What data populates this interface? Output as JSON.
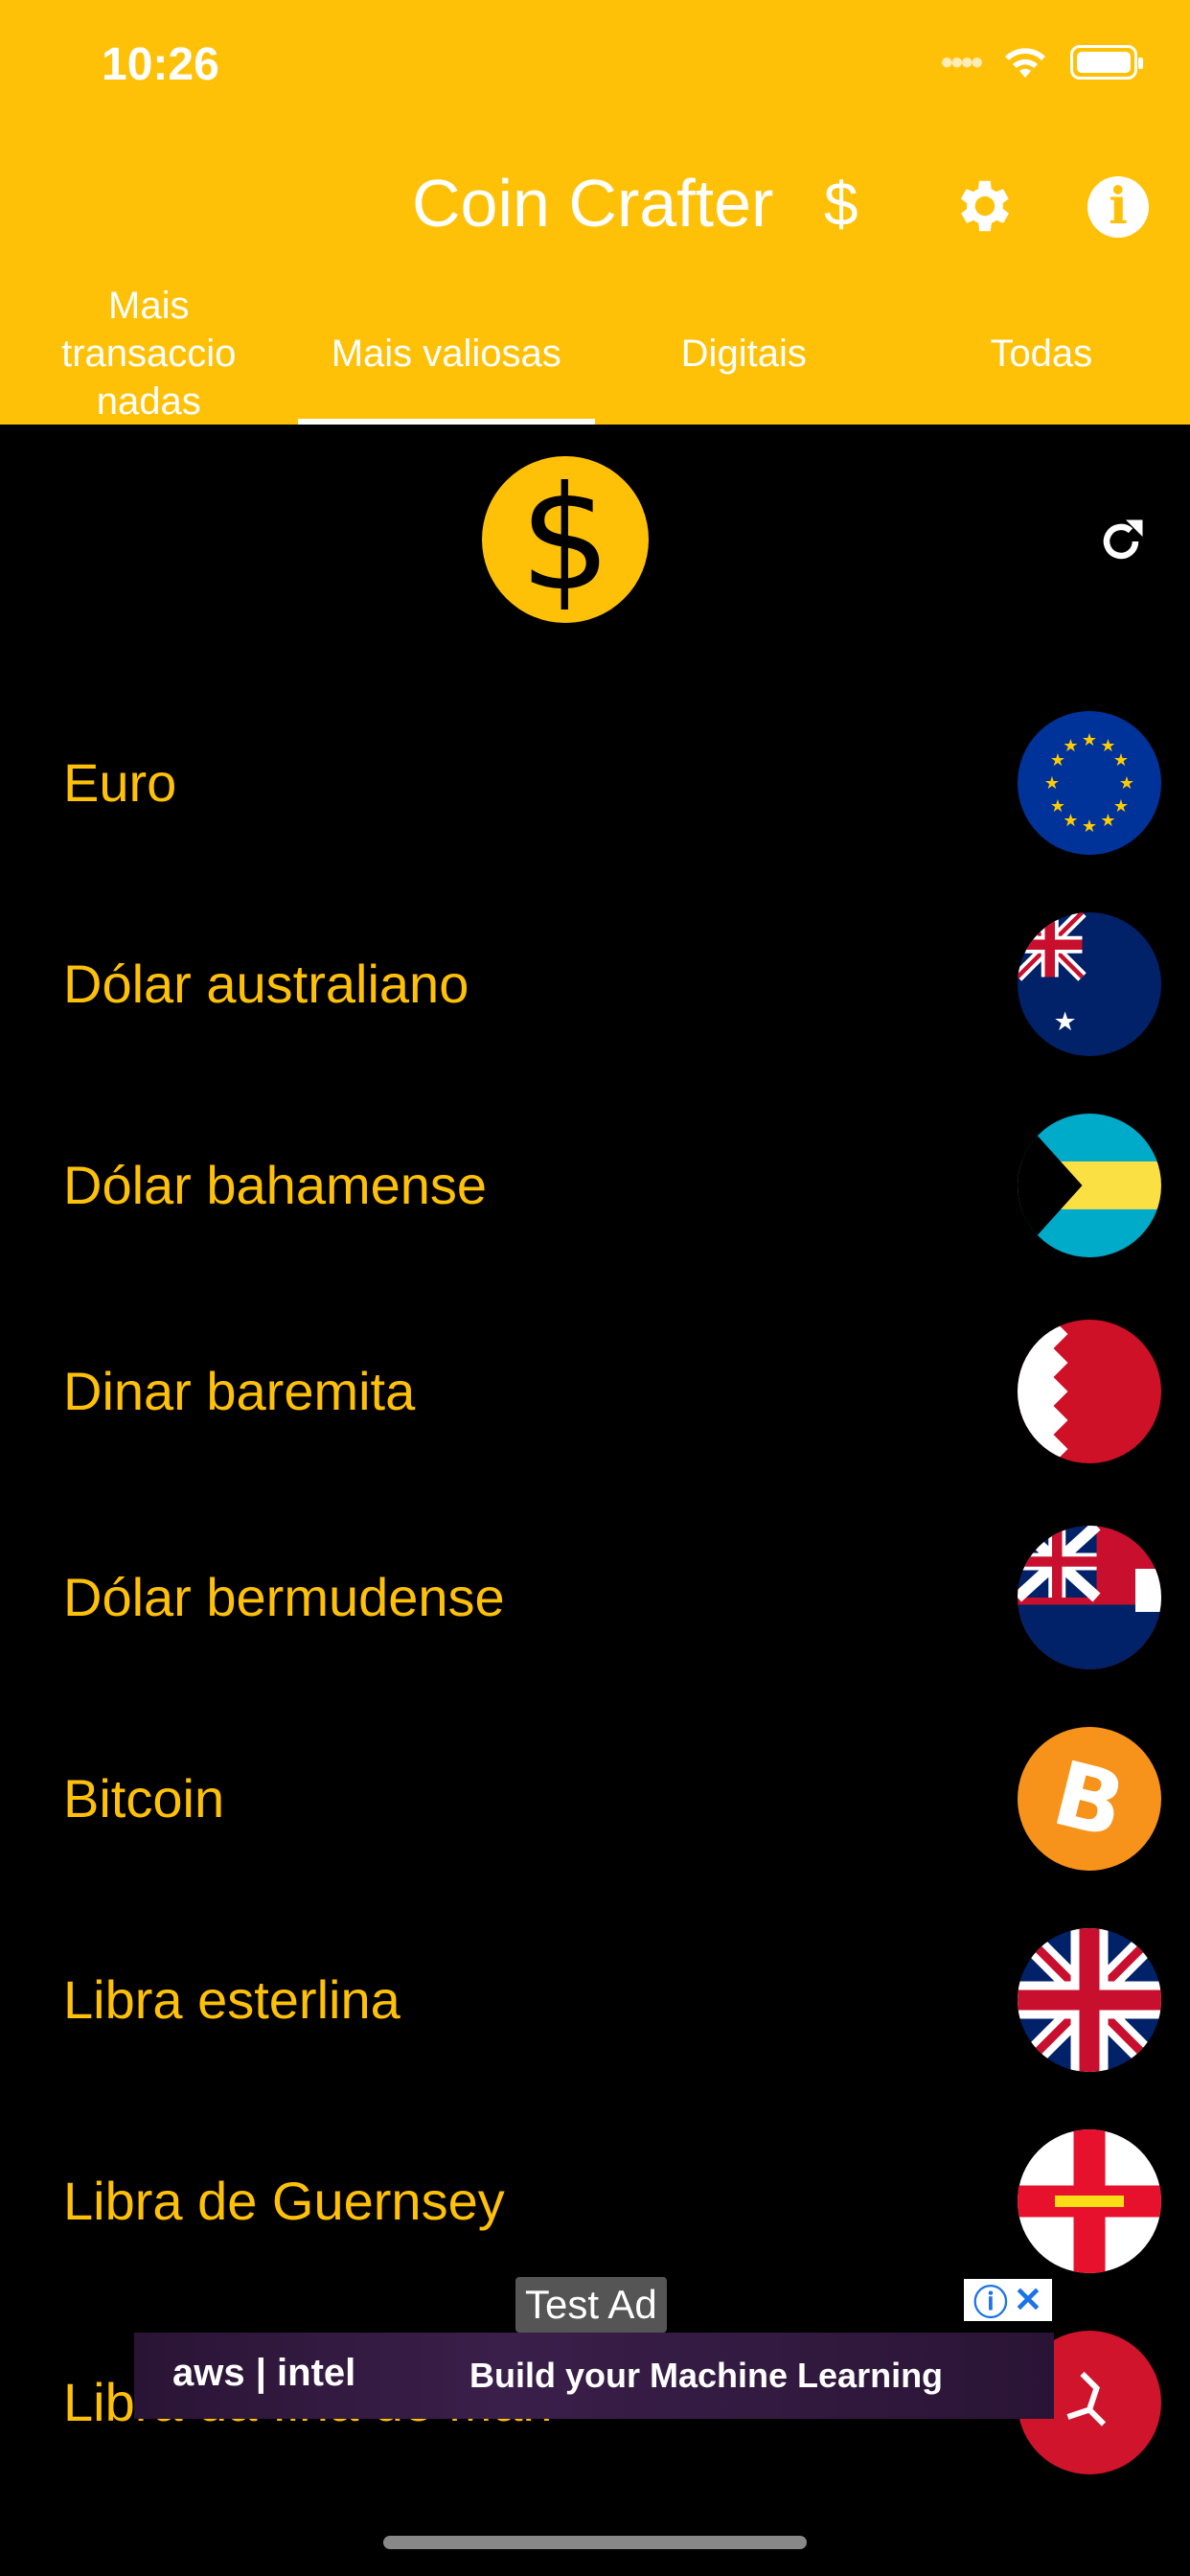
{
  "status_bar": {
    "time": "10:26"
  },
  "header": {
    "title": "Coin Crafter",
    "dollar_label": "$",
    "settings_icon": "gear-icon",
    "info_icon": "info-icon"
  },
  "tabs": [
    {
      "label": "Mais transaccio nadas",
      "active": false
    },
    {
      "label": "Mais valiosas",
      "active": true
    },
    {
      "label": "Digitais",
      "active": false
    },
    {
      "label": "Todas",
      "active": false
    }
  ],
  "logo": {
    "symbol": "$"
  },
  "currencies": [
    {
      "name": "Euro",
      "flag": "eu-flag"
    },
    {
      "name": "Dólar australiano",
      "flag": "australia-flag"
    },
    {
      "name": "Dólar bahamense",
      "flag": "bahamas-flag"
    },
    {
      "name": "Dinar baremita",
      "flag": "bahrain-flag"
    },
    {
      "name": "Dólar bermudense",
      "flag": "bermuda-flag"
    },
    {
      "name": "Bitcoin",
      "flag": "bitcoin-icon"
    },
    {
      "name": "Libra esterlina",
      "flag": "uk-flag"
    },
    {
      "name": "Libra de Guernsey",
      "flag": "guernsey-flag"
    },
    {
      "name": "Libra da Ilha de Man",
      "flag": "isle-of-man-flag"
    }
  ],
  "ad": {
    "badge": "Test Ad",
    "brand": "aws | intel",
    "text": "Build your Machine Learning"
  },
  "colors": {
    "accent": "#FFC107",
    "background": "#000000"
  }
}
